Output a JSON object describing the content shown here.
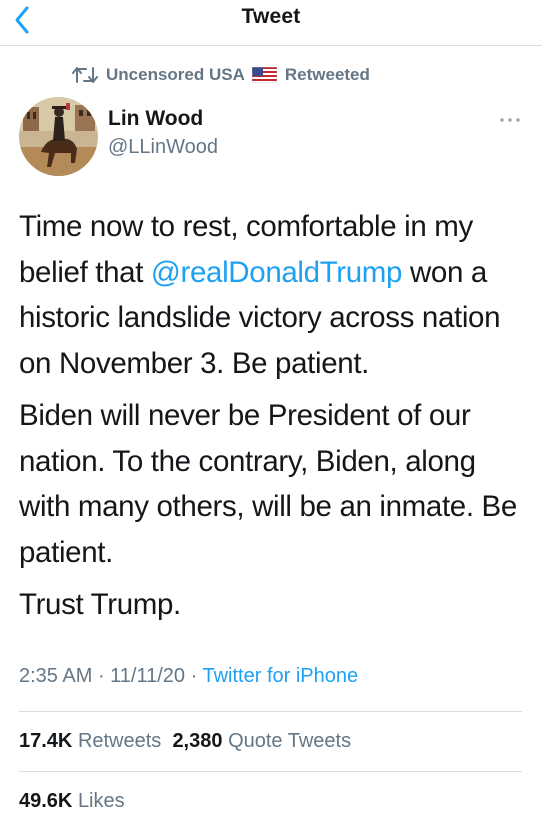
{
  "nav": {
    "title": "Tweet",
    "back_icon": "chevron-left-icon"
  },
  "colors": {
    "accent": "#1da1f2",
    "muted": "#657786",
    "text": "#14171a",
    "divider": "#d9dde1"
  },
  "retweet_context": {
    "account": "Uncensored USA",
    "suffix": "Retweeted",
    "icons": [
      "retweet-icon",
      "us-flag-icon"
    ]
  },
  "author": {
    "name": "Lin Wood",
    "handle": "@LLinWood"
  },
  "tweet": {
    "p1_before": "Time now to rest, comfortable in my belief that ",
    "mention": "@realDonaldTrump",
    "p1_after": " won a historic landslide victory across nation on November 3. Be patient.",
    "p2": "Biden will never be President of our nation. To the contrary, Biden, along with many others, will be an inmate. Be patient.",
    "p3": "Trust Trump."
  },
  "meta": {
    "time": "2:35 AM",
    "sep": " · ",
    "date": "11/11/20",
    "source": "Twitter for iPhone"
  },
  "stats": {
    "retweets_count": "17.4K",
    "retweets_label": "Retweets",
    "quotes_count": "2,380",
    "quotes_label": "Quote Tweets",
    "likes_count": "49.6K",
    "likes_label": "Likes"
  }
}
